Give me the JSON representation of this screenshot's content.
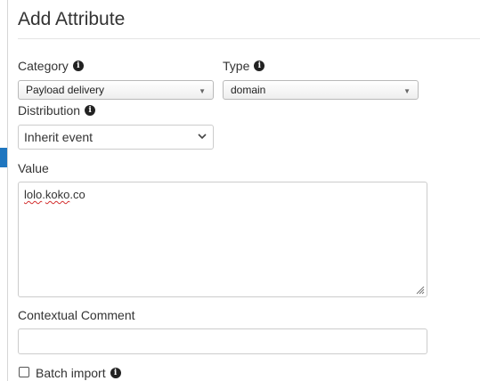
{
  "dialog": {
    "title": "Add Attribute"
  },
  "category": {
    "label": "Category",
    "value": "Payload delivery"
  },
  "type": {
    "label": "Type",
    "value": "domain"
  },
  "distribution": {
    "label": "Distribution",
    "value": "Inherit event"
  },
  "value_field": {
    "label": "Value",
    "words": [
      "lolo",
      ".",
      "koko",
      ".co"
    ]
  },
  "comment": {
    "label": "Contextual Comment",
    "value": ""
  },
  "batch": {
    "label": "Batch import",
    "checked": false
  },
  "icons": {
    "info": "info-circle-icon",
    "arrow": "triangle-down-icon",
    "chevron": "chevron-down-icon"
  },
  "colors": {
    "accent": "#1f76bf",
    "spellcheck": "#d32f2f"
  }
}
